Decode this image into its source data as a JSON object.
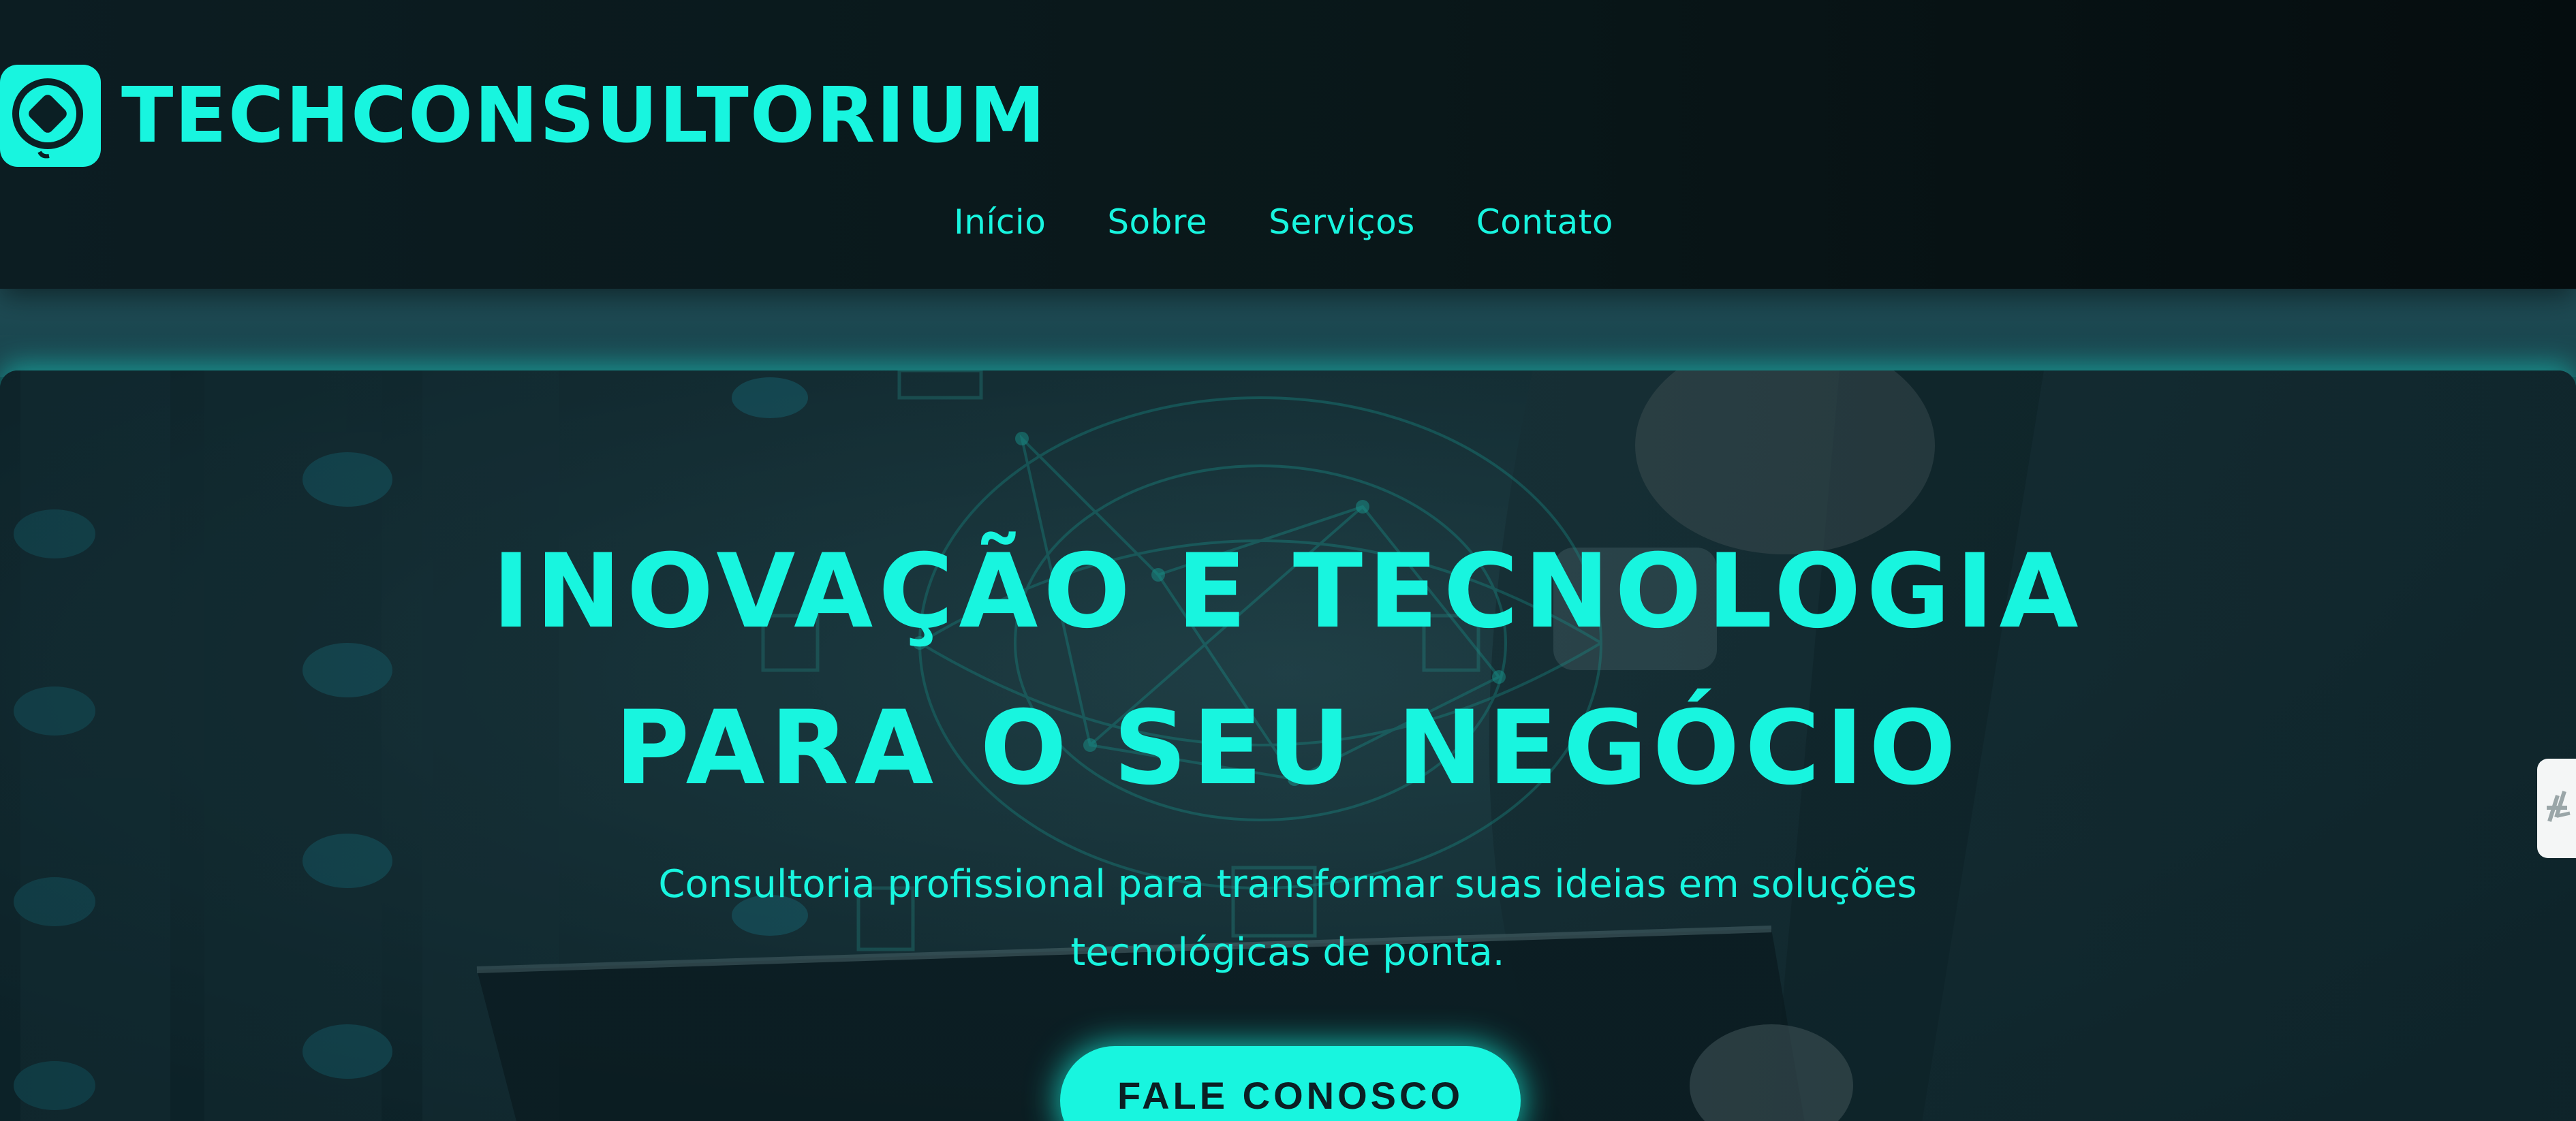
{
  "header": {
    "brand_name": "TECHCONSULTORIUM",
    "logo_icon": "diamond-logo-icon",
    "nav": [
      {
        "label": "Início"
      },
      {
        "label": "Sobre"
      },
      {
        "label": "Serviços"
      },
      {
        "label": "Contato"
      }
    ]
  },
  "hero": {
    "title_line1": "INOVAÇÃO E TECNOLOGIA",
    "title_line2": "PARA O SEU NEGÓCIO",
    "subtitle": "Consultoria profissional para transformar suas ideias em soluções tecnológicas de ponta.",
    "cta_label": "FALE CONOSCO"
  },
  "side_widget": {
    "icon": "accessibility-icon"
  },
  "colors": {
    "accent": "#18f5df",
    "header_bg": "#091719",
    "cta_text": "#0b1f24"
  }
}
